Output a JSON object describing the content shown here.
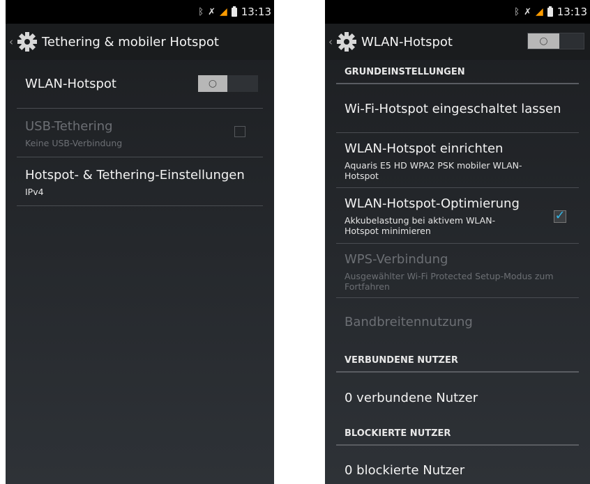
{
  "status_bar": {
    "time": "13:13",
    "icons": [
      "bluetooth-icon",
      "vibrate-icon",
      "signal-icon",
      "battery-icon"
    ]
  },
  "left_screen": {
    "title": "Tethering & mobiler Hotspot",
    "items": [
      {
        "title": "WLAN-Hotspot",
        "switch_state": "off"
      },
      {
        "title": "USB-Tethering",
        "subtitle": "Keine USB-Verbindung",
        "enabled": false,
        "checked": false
      },
      {
        "title": "Hotspot- & Tethering-Einstellungen",
        "subtitle": "IPv4"
      }
    ]
  },
  "right_screen": {
    "title": "WLAN-Hotspot",
    "switch_state": "off",
    "sections": [
      {
        "header": "GRUNDEINSTELLUNGEN",
        "items": [
          {
            "title": "Wi-Fi-Hotspot eingeschaltet lassen"
          },
          {
            "title": "WLAN-Hotspot einrichten",
            "subtitle": "Aquaris E5 HD WPA2 PSK mobiler WLAN-Hotspot"
          },
          {
            "title": "WLAN-Hotspot-Optimierung",
            "subtitle": "Akkubelastung bei aktivem WLAN-Hotspot minimieren",
            "checked": true
          },
          {
            "title": "WPS-Verbindung",
            "subtitle": "Ausgewählter Wi-Fi Protected Setup-Modus zum Fortfahren",
            "enabled": false
          },
          {
            "title": "Bandbreitennutzung",
            "enabled": false
          }
        ]
      },
      {
        "header": "VERBUNDENE NUTZER",
        "items": [
          {
            "title": "0 verbundene Nutzer"
          }
        ]
      },
      {
        "header": "BLOCKIERTE NUTZER",
        "items": [
          {
            "title": "0 blockierte Nutzer"
          }
        ]
      }
    ]
  },
  "colors": {
    "accent": "#33b5e5",
    "signal": "#ff9c00",
    "disabled_text": "#6c6f74"
  }
}
